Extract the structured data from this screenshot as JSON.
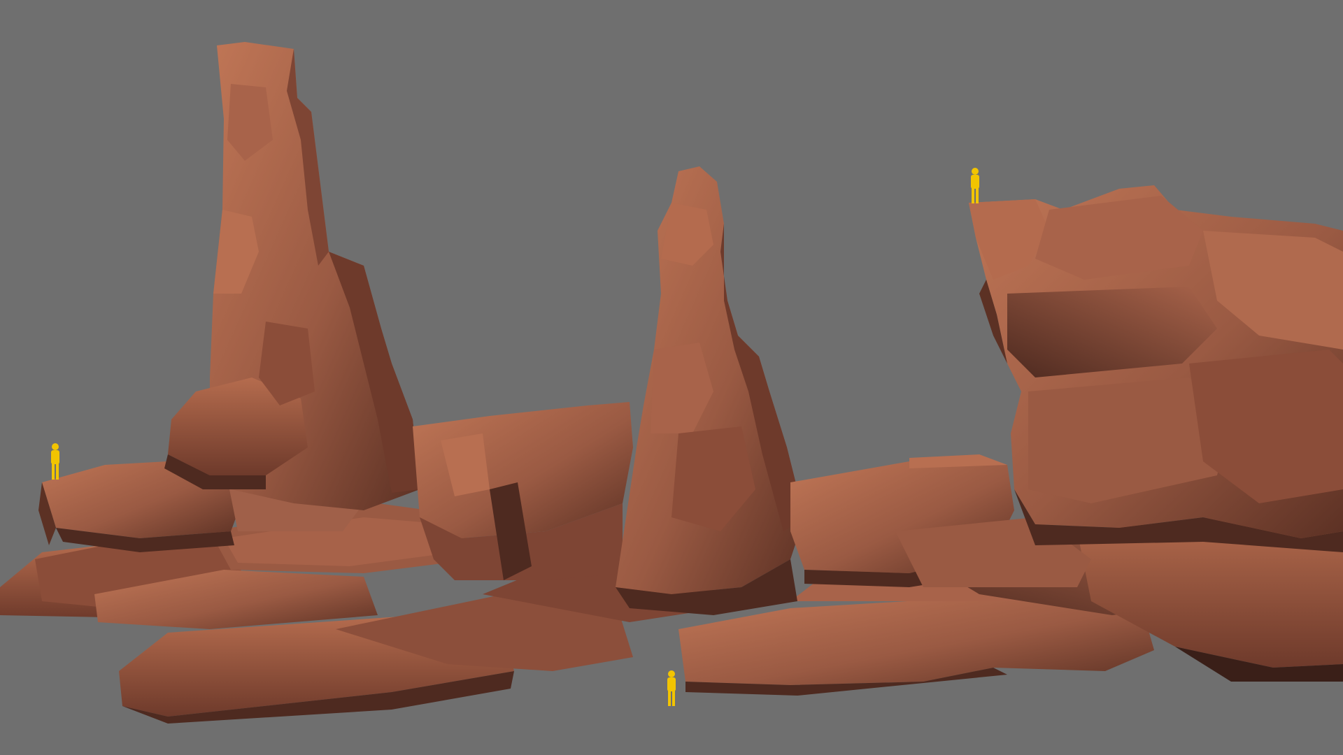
{
  "scene": {
    "background_color": "#6f6f6f",
    "rock_colors": {
      "highlight": "#c07656",
      "base": "#9a5a43",
      "mid": "#7e4534",
      "shadow": "#4e2a20",
      "deep_shadow": "#3a1f18"
    },
    "scale_figure_color": "#f2c400",
    "objects": [
      {
        "name": "tall-rock-spire",
        "kind": "rock-pillar"
      },
      {
        "name": "middle-rock-spire",
        "kind": "rock-pillar"
      },
      {
        "name": "right-rock-cliff",
        "kind": "rock-mass"
      },
      {
        "name": "ground-rock-slabs",
        "kind": "rock-slab-cluster"
      }
    ],
    "scale_figures": [
      {
        "name": "scale-figure-left-ledge",
        "icon": "standing-person-icon"
      },
      {
        "name": "scale-figure-cliff-top",
        "icon": "standing-person-icon"
      },
      {
        "name": "scale-figure-ground",
        "icon": "standing-person-icon"
      }
    ]
  }
}
